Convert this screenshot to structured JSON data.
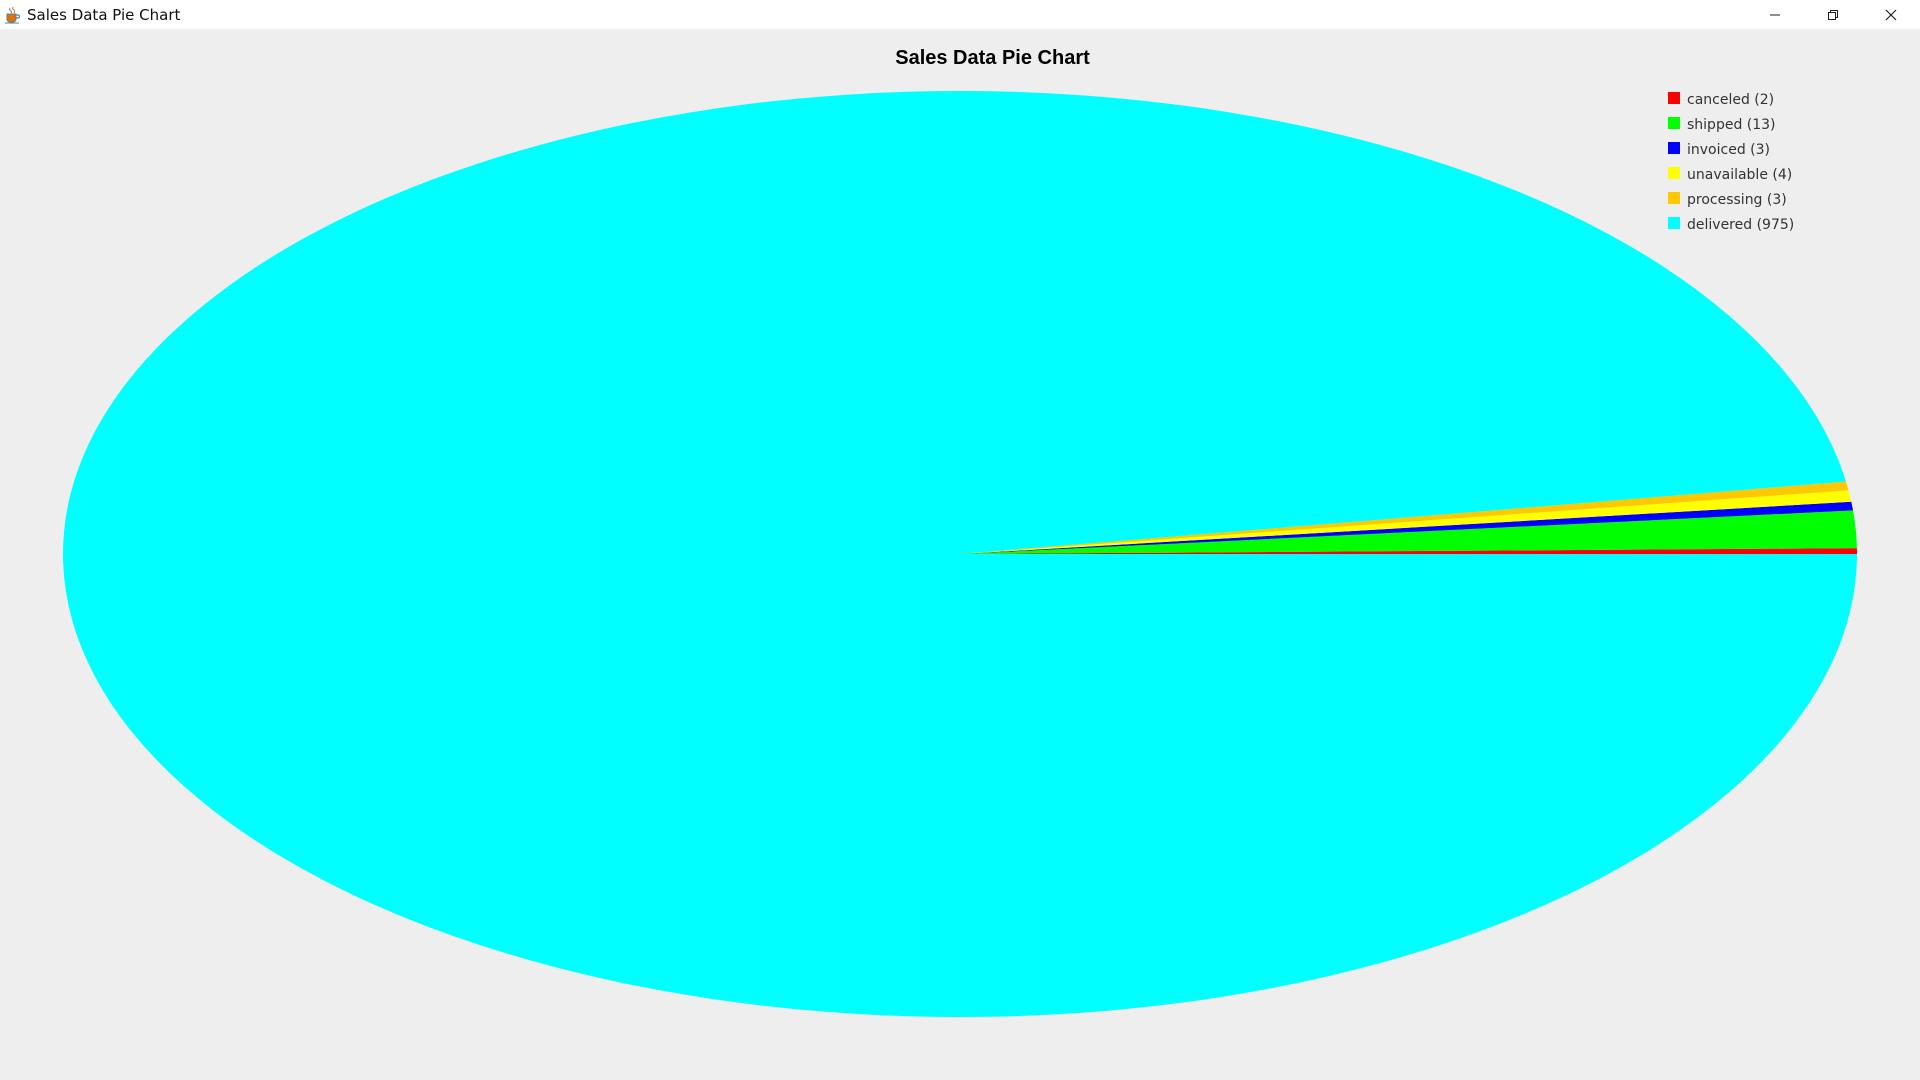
{
  "window": {
    "title": "Sales Data Pie Chart",
    "icons": {
      "app": "java-cup-icon",
      "minimize": "minimize-icon",
      "restore": "restore-icon",
      "close": "close-icon"
    }
  },
  "chart_data": {
    "type": "pie",
    "title": "Sales Data Pie Chart",
    "legend_position": "top-right",
    "slices": [
      {
        "label": "canceled",
        "value": 2,
        "legend": "canceled (2)",
        "color": "#ff0000"
      },
      {
        "label": "shipped",
        "value": 13,
        "legend": "shipped (13)",
        "color": "#00ff00"
      },
      {
        "label": "invoiced",
        "value": 3,
        "legend": "invoiced (3)",
        "color": "#0000ff"
      },
      {
        "label": "unavailable",
        "value": 4,
        "legend": "unavailable (4)",
        "color": "#ffff00"
      },
      {
        "label": "processing",
        "value": 3,
        "legend": "processing (3)",
        "color": "#ffc800"
      },
      {
        "label": "delivered",
        "value": 975,
        "legend": "delivered (975)",
        "color": "#00ffff"
      }
    ]
  }
}
